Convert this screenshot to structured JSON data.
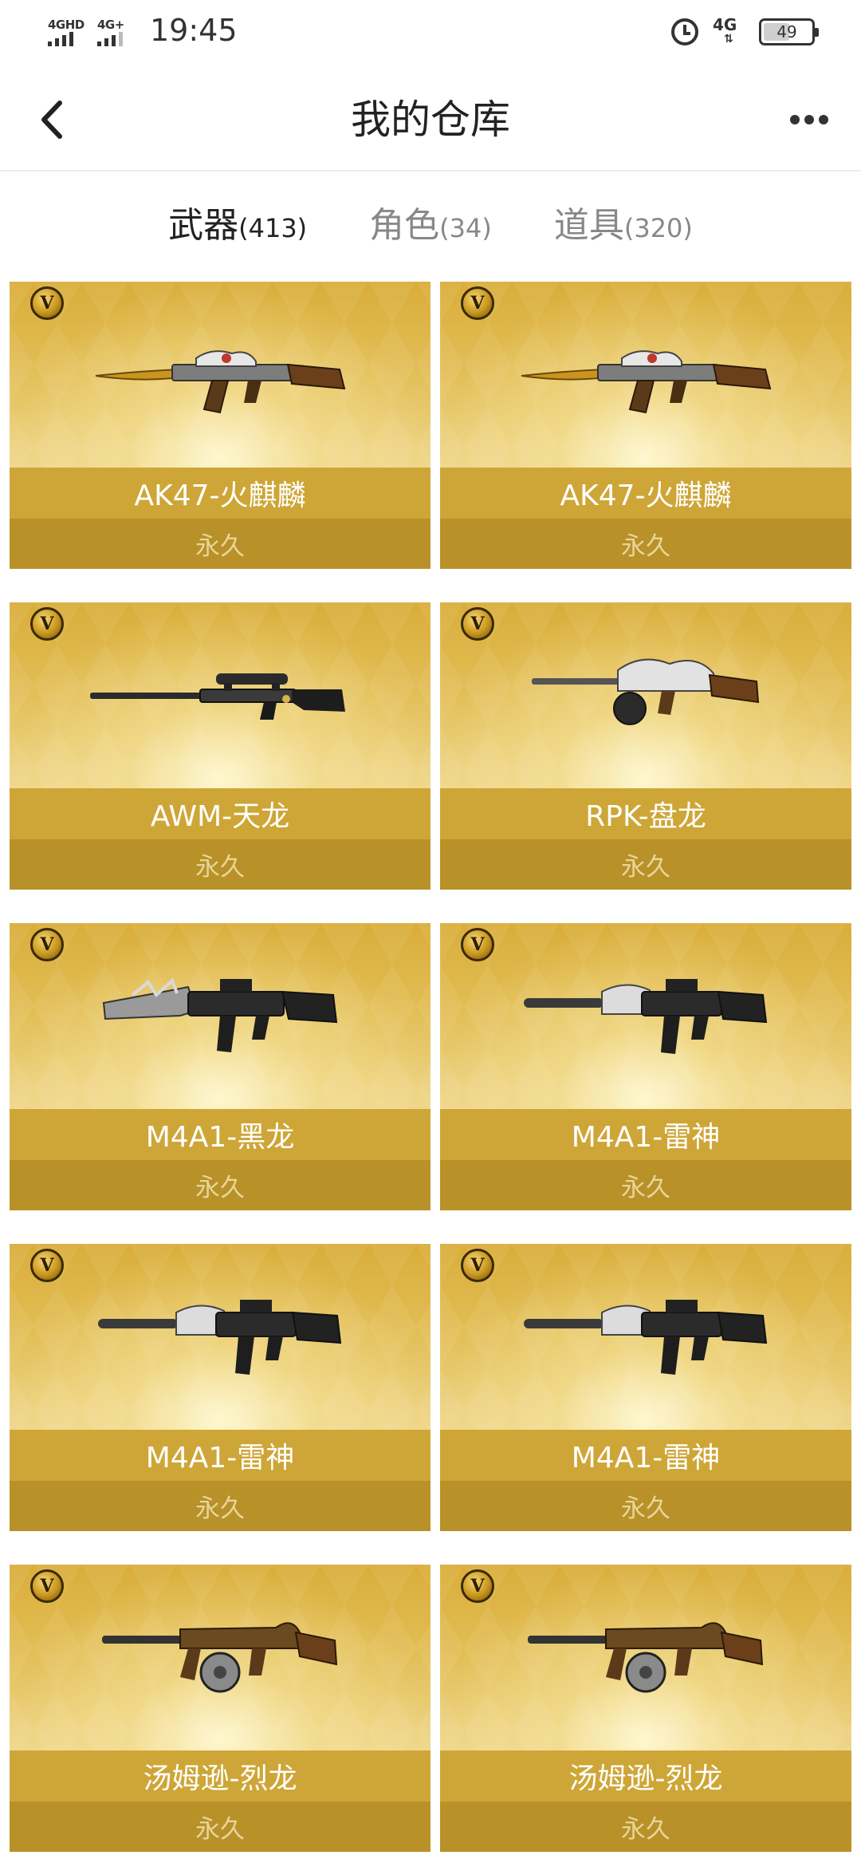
{
  "status_bar": {
    "network_left": "4GHD",
    "network_left2": "4G+",
    "time": "19:45",
    "network_right": "4G",
    "battery": "49"
  },
  "header": {
    "title": "我的仓库"
  },
  "tabs": [
    {
      "label": "武器",
      "count": "(413)",
      "active": true
    },
    {
      "label": "角色",
      "count": "(34)",
      "active": false
    },
    {
      "label": "道具",
      "count": "(320)",
      "active": false
    }
  ],
  "items": [
    {
      "name": "AK47-火麒麟",
      "duration": "永久",
      "weapon": "rifle-ak"
    },
    {
      "name": "AK47-火麒麟",
      "duration": "永久",
      "weapon": "rifle-ak"
    },
    {
      "name": "AWM-天龙",
      "duration": "永久",
      "weapon": "sniper"
    },
    {
      "name": "RPK-盘龙",
      "duration": "永久",
      "weapon": "lmg"
    },
    {
      "name": "M4A1-黑龙",
      "duration": "永久",
      "weapon": "rifle-m4"
    },
    {
      "name": "M4A1-雷神",
      "duration": "永久",
      "weapon": "rifle-m4-suppressed"
    },
    {
      "name": "M4A1-雷神",
      "duration": "永久",
      "weapon": "rifle-m4-suppressed"
    },
    {
      "name": "M4A1-雷神",
      "duration": "永久",
      "weapon": "rifle-m4-suppressed"
    },
    {
      "name": "汤姆逊-烈龙",
      "duration": "永久",
      "weapon": "smg-thompson"
    },
    {
      "name": "汤姆逊-烈龙",
      "duration": "永久",
      "weapon": "smg-thompson"
    }
  ],
  "colors": {
    "name_bar": "#cea637",
    "duration_bar": "#b89128",
    "duration_text": "#e9d59a"
  }
}
